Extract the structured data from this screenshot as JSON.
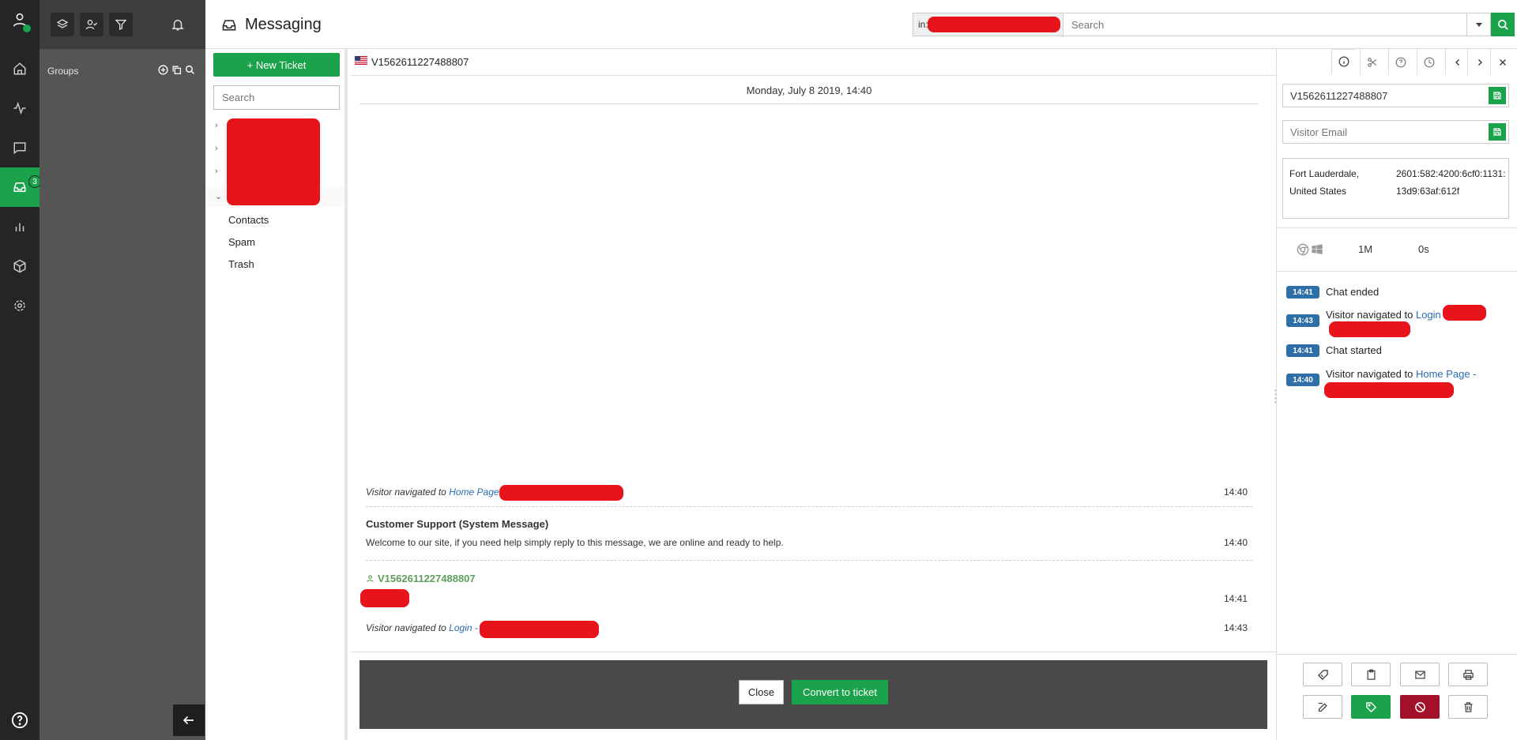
{
  "app": {
    "title": "Messaging"
  },
  "rail": {
    "items": [
      "user-icon",
      "home-icon",
      "activity-icon",
      "chat-icon",
      "inbox-icon",
      "chart-icon",
      "box-icon",
      "gear-icon",
      "help-icon"
    ],
    "inbox_badge": "3"
  },
  "groups": {
    "label": "Groups"
  },
  "header": {
    "search_prefix": "in:",
    "search_placeholder": "Search"
  },
  "list": {
    "new_ticket_label": "+ New Ticket",
    "search_placeholder": "Search",
    "folders": [
      "Contacts",
      "Spam",
      "Trash"
    ]
  },
  "chat": {
    "title": "V1562611227488807",
    "date": "Monday, July 8 2019, 14:40",
    "messages": [
      {
        "prefix": "Visitor navigated to",
        "link": "Home Page",
        "time": "14:40"
      },
      {
        "author": "Customer Support (System Message)",
        "text": "Welcome to our site, if you need help simply reply to this message, we are online and ready to help.",
        "time": "14:40"
      },
      {
        "author": "V1562611227488807",
        "time": "14:41"
      },
      {
        "prefix": "Visitor navigated to",
        "link": "Login -",
        "time": "14:43"
      }
    ],
    "close_label": "Close",
    "convert_label": "Convert to ticket"
  },
  "details": {
    "visitor_id": "V1562611227488807",
    "email_placeholder": "Visitor Email",
    "city": "Fort Lauderdale, United States",
    "ip": "2601:582:4200:6cf0:1131:13d9:63af:612f",
    "duration": "1M",
    "wait": "0s",
    "events": [
      {
        "time": "14:41",
        "text": "Chat ended"
      },
      {
        "time": "14:43",
        "text": "Visitor navigated to",
        "link": "Login"
      },
      {
        "time": "14:41",
        "text": "Chat started"
      },
      {
        "time": "14:40",
        "text": "Visitor navigated to",
        "link": "Home Page -"
      }
    ]
  },
  "colors": {
    "accent": "#1aa34a",
    "danger": "#a3102a",
    "badge": "#2f6fa8",
    "redaction": "#e8141c"
  }
}
